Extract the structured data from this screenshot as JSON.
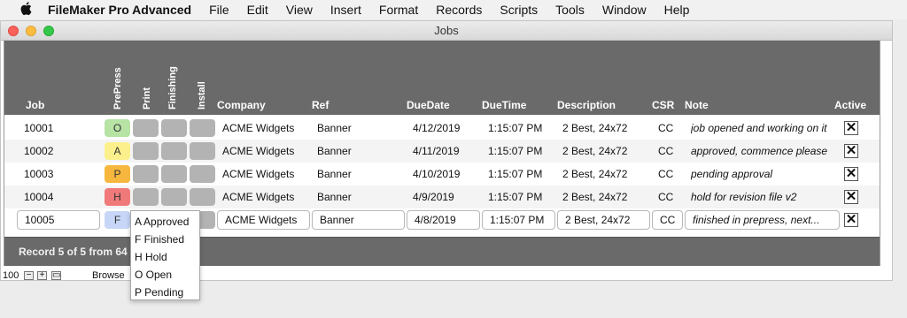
{
  "menubar": {
    "apple": "",
    "app": "FileMaker Pro Advanced",
    "items": [
      "File",
      "Edit",
      "View",
      "Insert",
      "Format",
      "Records",
      "Scripts",
      "Tools",
      "Window",
      "Help"
    ]
  },
  "window": {
    "title": "Jobs"
  },
  "headers": {
    "job": "Job",
    "prepress": "PrePress",
    "print": "Print",
    "finishing": "Finishing",
    "install": "Install",
    "company": "Company",
    "ref": "Ref",
    "duedate": "DueDate",
    "duetime": "DueTime",
    "description": "Description",
    "csr": "CSR",
    "note": "Note",
    "active": "Active"
  },
  "rows": [
    {
      "job": "10001",
      "stage": "O",
      "stage_color": "#b7e3a5",
      "company": "ACME Widgets",
      "ref": "Banner",
      "duedate": "4/12/2019",
      "duetime": "1:15:07 PM",
      "description": "2 Best, 24x72",
      "csr": "CC",
      "note": "job opened and working on it",
      "active": "✕"
    },
    {
      "job": "10002",
      "stage": "A",
      "stage_color": "#fbf08c",
      "company": "ACME Widgets",
      "ref": "Banner",
      "duedate": "4/11/2019",
      "duetime": "1:15:07 PM",
      "description": "2 Best, 24x72",
      "csr": "CC",
      "note": "approved, commence please",
      "active": "✕"
    },
    {
      "job": "10003",
      "stage": "P",
      "stage_color": "#f7b73e",
      "company": "ACME Widgets",
      "ref": "Banner",
      "duedate": "4/10/2019",
      "duetime": "1:15:07 PM",
      "description": "2 Best, 24x72",
      "csr": "CC",
      "note": "pending approval",
      "active": "✕"
    },
    {
      "job": "10004",
      "stage": "H",
      "stage_color": "#f07a7a",
      "company": "ACME Widgets",
      "ref": "Banner",
      "duedate": "4/9/2019",
      "duetime": "1:15:07 PM",
      "description": "2 Best, 24x72",
      "csr": "CC",
      "note": "hold for revision file v2",
      "active": "✕"
    },
    {
      "job": "10005",
      "stage": "F",
      "stage_color": "#c7d6f7",
      "company": "ACME Widgets",
      "ref": "Banner",
      "duedate": "4/8/2019",
      "duetime": "1:15:07 PM",
      "description": "2 Best, 24x72",
      "csr": "CC",
      "note": "finished in prepress, next...",
      "active": "✕"
    }
  ],
  "footer": {
    "record_status": "Record 5 of 5 from 64"
  },
  "statusbar": {
    "zoom": "100",
    "zoom_out": "−",
    "zoom_in": "+",
    "toggle": "▭",
    "mode": "Browse"
  },
  "dropdown": {
    "items": [
      "A Approved",
      "F Finished",
      "H Hold",
      "O Open",
      "P Pending"
    ]
  }
}
